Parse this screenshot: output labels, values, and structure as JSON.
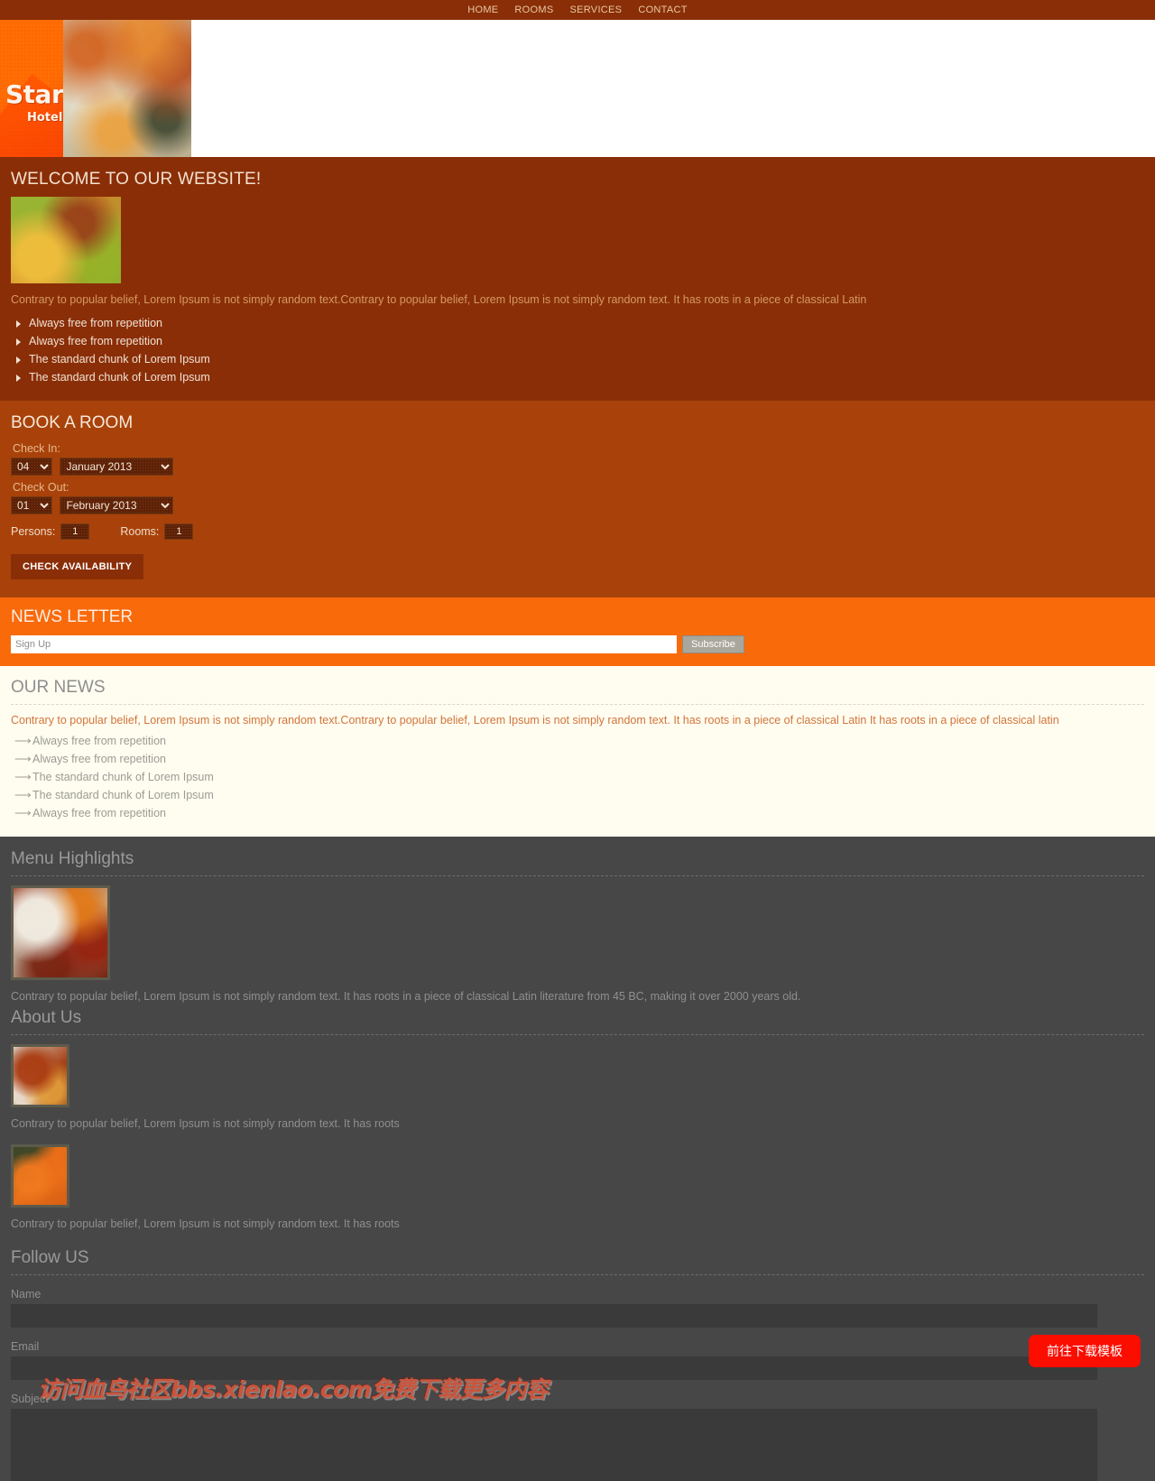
{
  "nav": {
    "items": [
      {
        "label": "HOME",
        "name": "nav-item-home"
      },
      {
        "label": "ROOMS",
        "name": "nav-item-rooms"
      },
      {
        "label": "SERVICES",
        "name": "nav-item-services"
      },
      {
        "label": "CONTACT",
        "name": "nav-item-contact"
      }
    ]
  },
  "logo": {
    "word": "Star",
    "sub": "Hotel"
  },
  "welcome": {
    "title": "WELCOME TO OUR WEBSITE!",
    "description": "Contrary to popular belief, Lorem Ipsum is not simply random text.Contrary to popular belief, Lorem Ipsum is not simply random text. It has roots in a piece of classical Latin",
    "items": [
      "Always free from repetition",
      "Always free from repetition",
      "The standard chunk of Lorem Ipsum",
      "The standard chunk of Lorem Ipsum"
    ]
  },
  "book": {
    "title": "BOOK A ROOM",
    "checkin_label": "Check In:",
    "checkout_label": "Check Out:",
    "checkin_day": "04",
    "checkin_month": "January 2013",
    "checkout_day": "01",
    "checkout_month": "February 2013",
    "persons_label": "Persons:",
    "persons_value": "1",
    "rooms_label": "Rooms:",
    "rooms_value": "1",
    "submit_label": "CHECK AVAILABILITY"
  },
  "newsletter": {
    "title": "NEWS LETTER",
    "placeholder": "Sign Up",
    "value": "",
    "subscribe_label": "Subscribe"
  },
  "ournews": {
    "title": "OUR NEWS",
    "description": "Contrary to popular belief, Lorem Ipsum is not simply random text.Contrary to popular belief, Lorem Ipsum is not simply random text. It has roots in a piece of classical Latin It has roots in a piece of classical latin",
    "items": [
      "Always free from repetition",
      "Always free from repetition",
      "The standard chunk of Lorem Ipsum",
      "The standard chunk of Lorem Ipsum",
      "Always free from repetition"
    ]
  },
  "menu_highlights": {
    "title": "Menu Highlights",
    "description": "Contrary to popular belief, Lorem Ipsum is not simply random text. It has roots in a piece of classical Latin literature from 45 BC, making it over 2000 years old."
  },
  "about": {
    "title": "About Us",
    "entries": [
      "Contrary to popular belief, Lorem Ipsum is not simply random text. It has roots",
      "Contrary to popular belief, Lorem Ipsum is not simply random text. It has roots"
    ]
  },
  "follow": {
    "title": "Follow US",
    "name_label": "Name",
    "name_value": "",
    "email_label": "Email",
    "email_value": "",
    "subject_label": "Subject",
    "subject_value": ""
  },
  "overlay": {
    "watermark": "访问血鸟社区bbs.xienlao.com免费下载更多内容",
    "download_button": "前往下载模板"
  },
  "colors": {
    "nav_bar": "#8a2e08",
    "welcome_bg": "#8a2e08",
    "book_bg": "#a8420a",
    "newsletter_bg": "#f96a0b",
    "ournews_bg": "#fffdf0",
    "dark_bg": "#474747",
    "accent_orange": "#ff6a00",
    "download_red": "#fb0d00"
  }
}
